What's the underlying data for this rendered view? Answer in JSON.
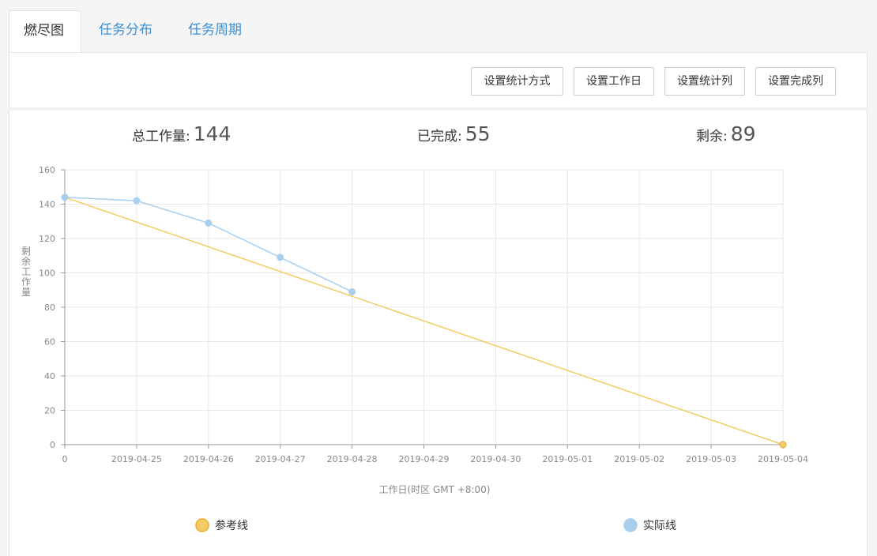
{
  "tabs": [
    {
      "label": "燃尽图",
      "active": true
    },
    {
      "label": "任务分布",
      "active": false
    },
    {
      "label": "任务周期",
      "active": false
    }
  ],
  "toolbar": {
    "stat_method_label": "设置统计方式",
    "workday_label": "设置工作日",
    "stat_column_label": "设置统计列",
    "done_column_label": "设置完成列"
  },
  "summary": {
    "total_label": "总工作量:",
    "total_value": "144",
    "done_label": "已完成:",
    "done_value": "55",
    "remaining_label": "剩余:",
    "remaining_value": "89"
  },
  "colors": {
    "accent": "#3a8fd6",
    "reference_line": "#f5cc67",
    "actual_line": "#a8cfee"
  },
  "chart_data": {
    "type": "line",
    "categories": [
      "0",
      "2019-04-25",
      "2019-04-26",
      "2019-04-27",
      "2019-04-28",
      "2019-04-29",
      "2019-04-30",
      "2019-05-01",
      "2019-05-02",
      "2019-05-03",
      "2019-05-04"
    ],
    "xlabel": "工作日(时区 GMT +8:00)",
    "ylabel": "剩余工作量",
    "ylim": [
      0,
      160
    ],
    "yticks": [
      0,
      20,
      40,
      60,
      80,
      100,
      120,
      140,
      160
    ],
    "grid": true,
    "legend_position": "bottom",
    "series": [
      {
        "name": "参考线",
        "color": "#f5cc67",
        "values": [
          144,
          null,
          null,
          null,
          null,
          null,
          null,
          null,
          null,
          null,
          0
        ]
      },
      {
        "name": "实际线",
        "color": "#a8cfee",
        "values": [
          144,
          142,
          129,
          109,
          89
        ]
      }
    ]
  }
}
